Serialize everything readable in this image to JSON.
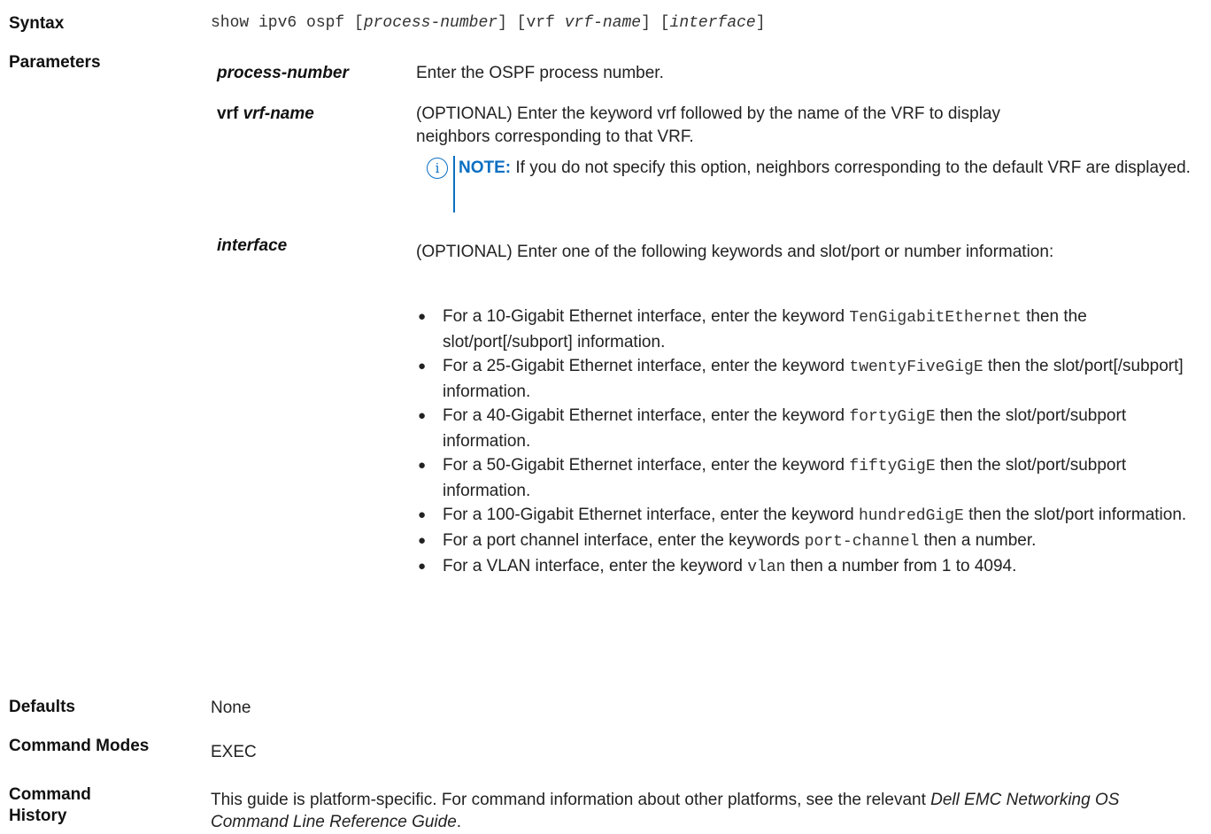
{
  "syntax": {
    "label": "Syntax",
    "cmd_base": "show ipv6 ospf [",
    "arg1": "process-number",
    "mid1": "] [vrf ",
    "arg2": "vrf-name",
    "mid2": "] [",
    "arg3": "interface",
    "end": "]"
  },
  "parameters": {
    "label": "Parameters",
    "p1": {
      "name": "process-number",
      "desc": "Enter the OSPF process number."
    },
    "p2": {
      "keyword": "vrf",
      "name": "vrf-name",
      "desc_line1": "(OPTIONAL) Enter the keyword vrf followed by the name of the VRF to display",
      "desc_line2": "neighbors corresponding to that VRF.",
      "note_label": "NOTE:",
      "note_text": " If you do not specify this option, neighbors corresponding to the default VRF are displayed."
    },
    "p3": {
      "name": "interface",
      "desc": "(OPTIONAL) Enter one of the following keywords and slot/port or number information:",
      "items": [
        {
          "pre": "For a 10-Gigabit Ethernet interface, enter the keyword ",
          "kw": "TenGigabitEthernet",
          "post": " then the slot/port[/subport] information."
        },
        {
          "pre": "For a 25-Gigabit Ethernet interface, enter the keyword ",
          "kw": "twentyFiveGigE",
          "post": " then the slot/port[/subport] information."
        },
        {
          "pre": "For a 40-Gigabit Ethernet interface, enter the keyword ",
          "kw": "fortyGigE",
          "post": " then the slot/port/subport information."
        },
        {
          "pre": "For a 50-Gigabit Ethernet interface, enter the keyword ",
          "kw": "fiftyGigE",
          "post": " then the slot/port/subport information."
        },
        {
          "pre": "For a 100-Gigabit Ethernet interface, enter the keyword ",
          "kw": "hundredGigE",
          "post": " then the slot/port information."
        },
        {
          "pre": "For a port channel interface, enter the keywords ",
          "kw": "port-channel",
          "post": " then a number."
        },
        {
          "pre": "For a VLAN interface, enter the keyword ",
          "kw": "vlan",
          "post": " then a number from 1 to 4094."
        }
      ]
    }
  },
  "defaults": {
    "label": "Defaults",
    "value": "None"
  },
  "command_modes": {
    "label": "Command Modes",
    "value": "EXEC"
  },
  "command_history": {
    "label_line1": "Command",
    "label_line2": "History",
    "text_pre": "This guide is platform-specific. For command information about other platforms, see the relevant ",
    "text_ital_a": "Dell",
    "text_ital_b": "EMC Networking OS Command Line Reference Guide",
    "text_post": "."
  },
  "colors": {
    "note_accent": "#0a6fc2"
  },
  "icons": {
    "note": "info-circle-icon"
  }
}
